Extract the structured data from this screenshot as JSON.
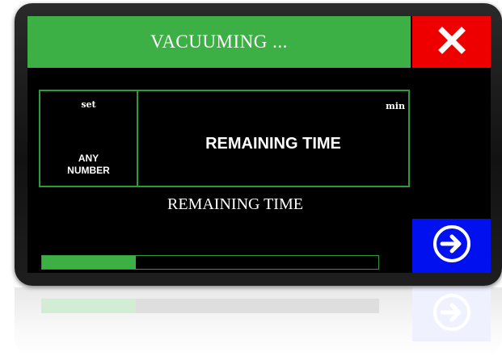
{
  "header": {
    "title": "VACUUMING ..."
  },
  "colors": {
    "title_bar": "#3cb045",
    "close_button": "#ee0000",
    "next_button": "#0010ee",
    "screen_background": "#000000",
    "border": "#2f9a38",
    "text": "#ffffff"
  },
  "icons": {
    "close": "close-x-icon",
    "next": "arrow-right-circle-icon"
  },
  "setpoint": {
    "label": "set",
    "value": "ANY\nNUMBER"
  },
  "timer": {
    "unit": "min",
    "label": "REMAINING TIME",
    "secondary_label": "REMAINING TIME"
  },
  "progress": {
    "fraction": 0.28
  }
}
